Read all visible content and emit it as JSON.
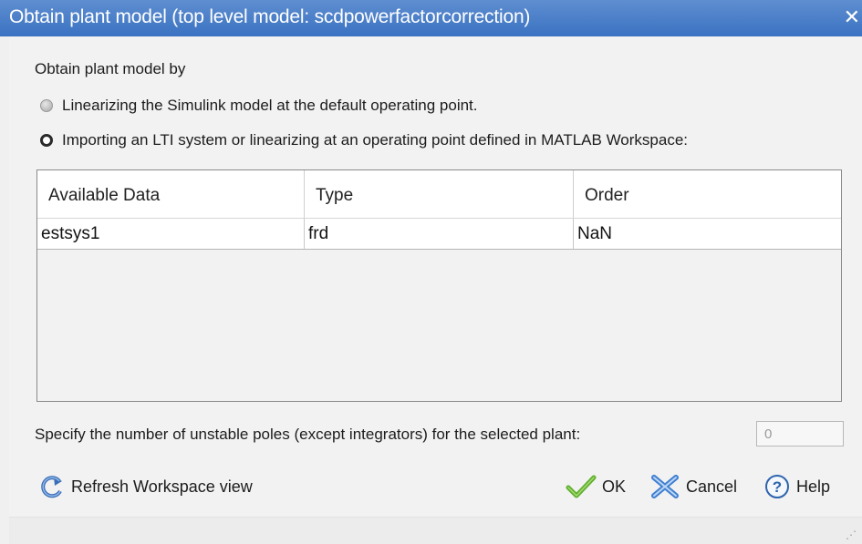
{
  "window": {
    "title": "Obtain plant model (top level model: scdpowerfactorcorrection)",
    "close_glyph": "✕"
  },
  "section_label": "Obtain plant model by",
  "options": [
    {
      "label": "Linearizing the Simulink model at the default operating point.",
      "selected": false
    },
    {
      "label": "Importing an LTI system or linearizing at an operating point defined in MATLAB Workspace:",
      "selected": true
    }
  ],
  "table": {
    "columns": [
      "Available Data",
      "Type",
      "Order"
    ],
    "rows": [
      [
        "estsys1",
        "frd",
        "NaN"
      ]
    ]
  },
  "unstable_poles": {
    "label": "Specify the number of unstable poles (except integrators) for the selected plant:",
    "value": "0"
  },
  "buttons": {
    "refresh": "Refresh Workspace view",
    "ok": "OK",
    "cancel": "Cancel",
    "help": "Help"
  },
  "icons": {
    "refresh": "refresh-arrow-icon",
    "ok": "green-checkmark-icon",
    "cancel": "blue-x-icon",
    "help": "question-mark-icon",
    "accent": "#3a72c2",
    "ok_color": "#5fae2e",
    "cancel_color": "#3f7fd0"
  }
}
